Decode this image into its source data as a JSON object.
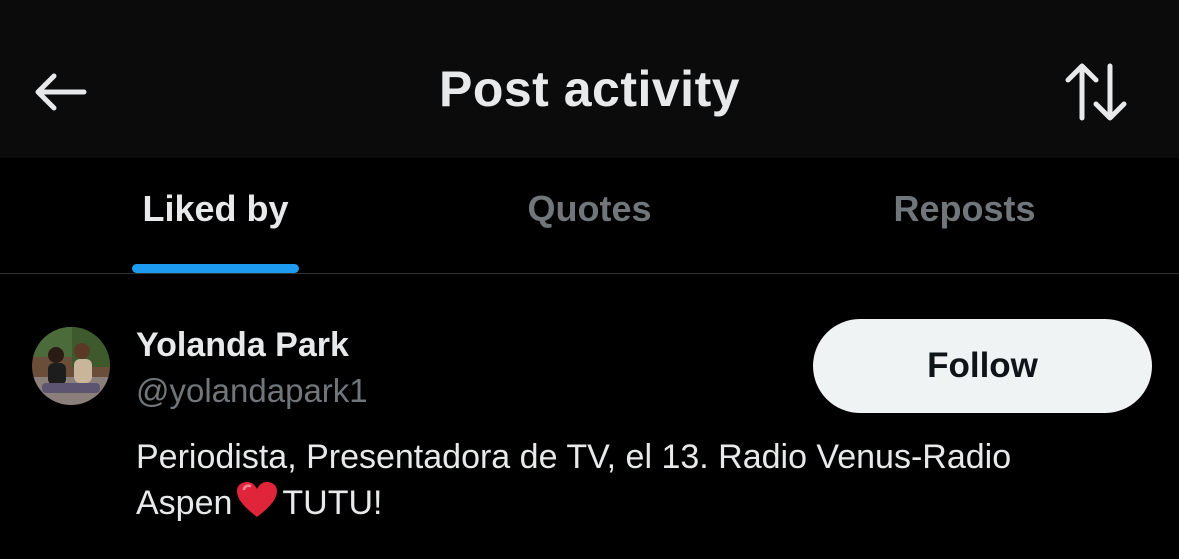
{
  "header": {
    "title": "Post activity",
    "back_icon": "arrow-left-icon",
    "sort_icon": "sort-arrows-icon"
  },
  "tabs": [
    {
      "label": "Liked by",
      "active": true
    },
    {
      "label": "Quotes",
      "active": false
    },
    {
      "label": "Reposts",
      "active": false
    }
  ],
  "user": {
    "name": "Yolanda Park",
    "handle": "@yolandapark1",
    "follow_label": "Follow",
    "bio_line1": "Periodista, Presentadora de TV, el 13. Radio Venus-Radio",
    "bio_before_heart": "Aspen",
    "bio_after_heart": "TUTU!",
    "bio_icon": "red-heart-icon"
  },
  "colors": {
    "background": "#000000",
    "header_bg": "#0b0b0b",
    "accent": "#1d9bf0",
    "text_primary": "#e7e9ea",
    "text_secondary": "#71767b",
    "follow_bg": "#eff3f4"
  }
}
